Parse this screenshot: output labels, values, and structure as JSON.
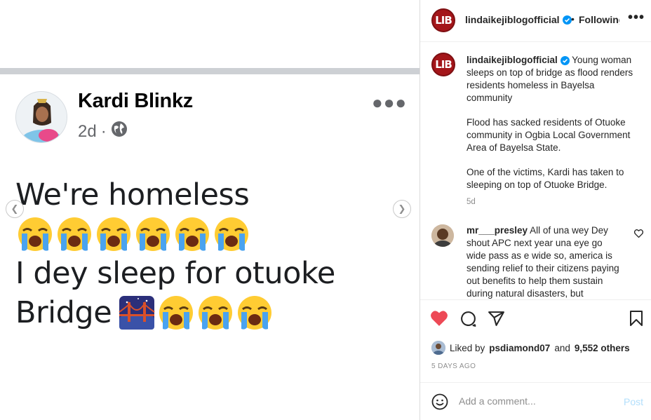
{
  "media": {
    "author_name": "Kardi Blinkz",
    "post_age": "2d",
    "separator": "·",
    "post_lines": [
      "We're homeless",
      "I dey sleep for otuoke",
      "Bridge"
    ],
    "icons": {
      "more": "more-horizontal-icon",
      "globe": "globe-icon",
      "prev": "chevron-left-icon",
      "next": "chevron-right-icon",
      "crying": "loudly-crying-face-emoji",
      "bridge": "bridge-at-night-emoji"
    }
  },
  "header": {
    "logo_text": "LIB",
    "username": "lindaikejiblogofficial",
    "dot": "•",
    "follow_label": "Following",
    "more_icon": "more-horizontal-icon"
  },
  "caption": {
    "logo_text": "LIB",
    "username": "lindaikejiblogofficial",
    "headline": "Young woman sleeps on top of bridge as flood renders residents homeless in Bayelsa community",
    "paragraph1": "Flood has sacked residents of Otuoke community in Ogbia Local Government Area of Bayelsa State.",
    "paragraph2": "One of the victims, Kardi has taken to sleeping on top of Otuoke Bridge.",
    "time": "5d"
  },
  "comment": {
    "username": "mr___presley",
    "text": "All of una wey Dey shout APC next year una eye go wide pass as e wide so, america is sending relief to their citizens paying out benefits to help them sustain during natural disasters, but"
  },
  "actions": {
    "liked_prefix": "Liked by",
    "liked_user": "psdiamond07",
    "and_label": "and",
    "others_label": "9,552 others",
    "days_ago": "5 DAYS AGO",
    "icons": [
      "heart-filled-icon",
      "comment-icon",
      "share-icon",
      "bookmark-icon"
    ],
    "heart_color": "#ed4956"
  },
  "composer": {
    "placeholder": "Add a comment...",
    "post_label": "Post",
    "emoji_icon": "smiley-icon"
  },
  "colors": {
    "lib_red": "#a4161a",
    "verified_blue": "#0095f6",
    "post_disabled": "#b2dffc"
  }
}
